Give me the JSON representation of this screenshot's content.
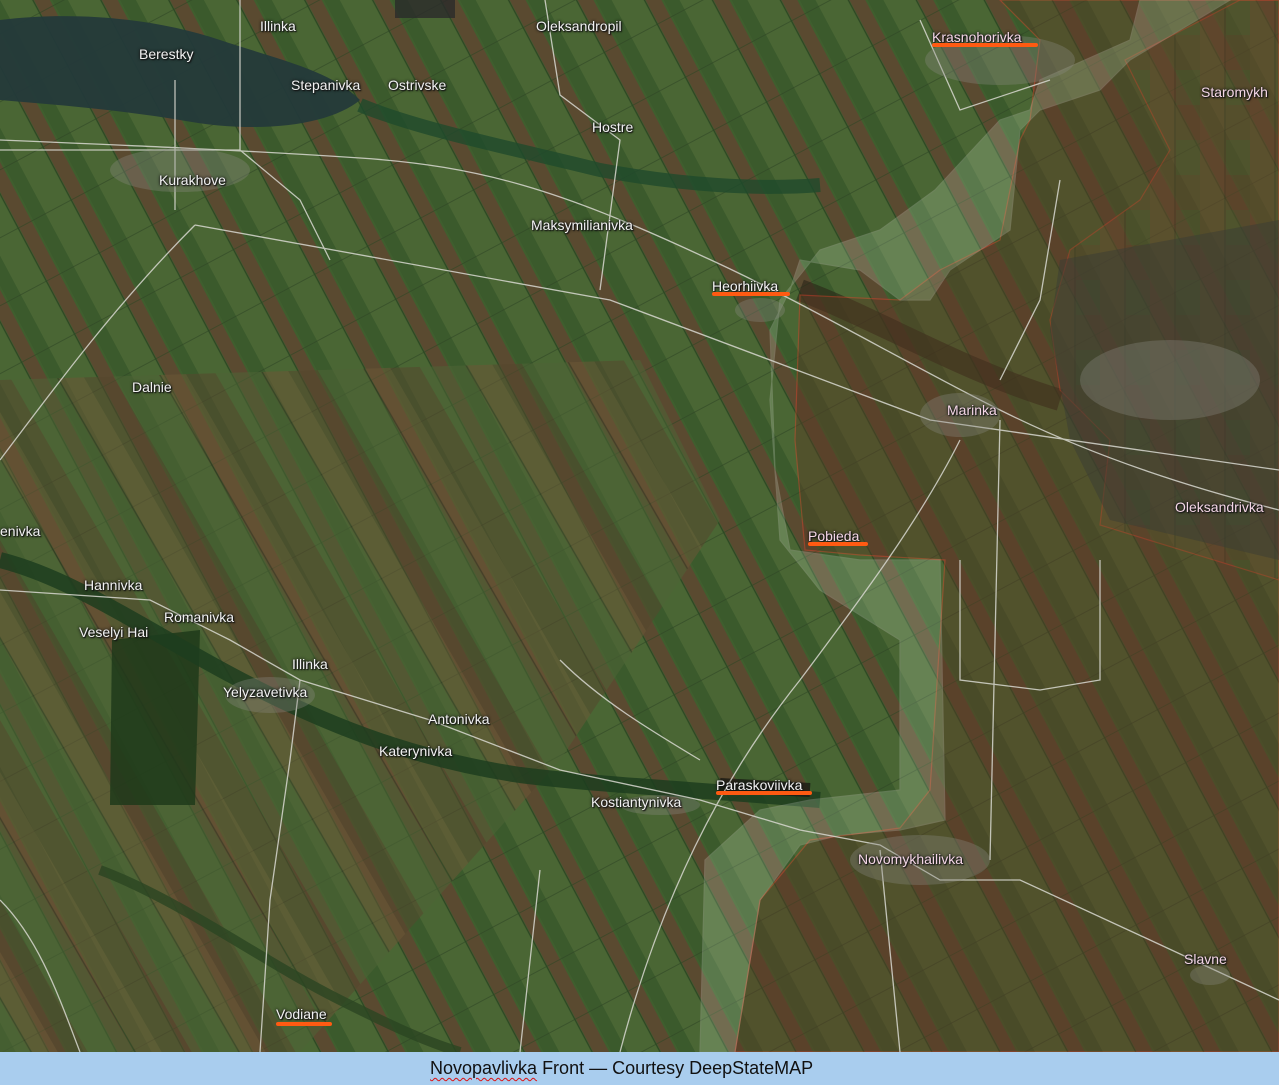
{
  "map": {
    "labels": {
      "illinka_n": "Illinka",
      "oleksandropil": "Oleksandropil",
      "krasnohorivka": "Krasnohorivka",
      "berestky": "Berestky",
      "stepanivka": "Stepanivka",
      "ostrivske": "Ostrivske",
      "staromykh": "Staromykh",
      "hostre": "Hostre",
      "kurakhove": "Kurakhove",
      "maksymilianivka": "Maksymilianivka",
      "heorhiivka": "Heorhiivka",
      "dalnie": "Dalnie",
      "marinka": "Marinka",
      "oleksandrivka": "Oleksandrivka",
      "enivka": "enivka",
      "pobieda": "Pobieda",
      "hannivka": "Hannivka",
      "romanivka": "Romanivka",
      "veselyi_hai": "Veselyi Hai",
      "illinka_s": "Illinka",
      "yelyzavetivka": "Yelyzavetivka",
      "antonivka": "Antonivka",
      "katerynivka": "Katerynivka",
      "paraskoviivka": "Paraskoviivka",
      "kostiantynivka": "Kostiantynivka",
      "novomykhailivka": "Novomykhailivka",
      "slavne": "Slavne",
      "vodiane": "Vodiane"
    },
    "colors": {
      "highlight_underline": "#ff5a12",
      "occupied_border": "#e0402a",
      "contested_fill": "#c8e6c0"
    }
  },
  "caption": {
    "word1": "Novopavlivka",
    "rest": " Front — Courtesy DeepStateMAP"
  }
}
